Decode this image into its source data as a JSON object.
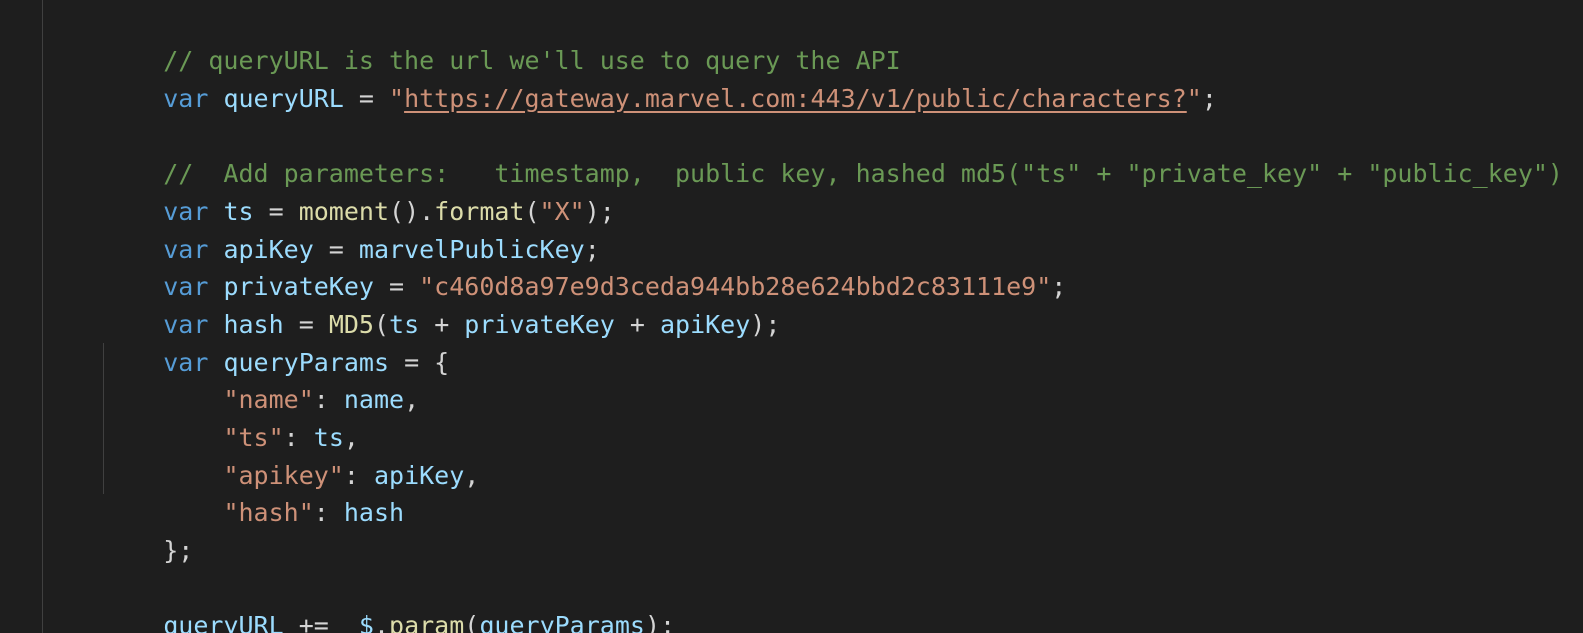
{
  "editor": {
    "l1": {
      "comment": "// queryURL is the url we'll use to query the API"
    },
    "l2": {
      "kw": "var",
      "sp1": " ",
      "name": "queryURL",
      "eq": " = ",
      "q1": "\"",
      "url": "https://gateway.marvel.com:443/v1/public/characters?",
      "q2": "\"",
      "semi": ";"
    },
    "l4": {
      "comment": "//  Add parameters:   timestamp,  public key, hashed md5(\"ts\" + \"private_key\" + \"public_key\")"
    },
    "l5": {
      "kw": "var",
      "sp1": " ",
      "name": "ts",
      "eq": " = ",
      "fn1": "moment",
      "p1": "().",
      "fn2": "format",
      "p2": "(",
      "str": "\"X\"",
      "p3": ");"
    },
    "l6": {
      "kw": "var",
      "sp1": " ",
      "name": "apiKey",
      "eq": " = ",
      "val": "marvelPublicKey",
      "semi": ";"
    },
    "l7": {
      "kw": "var",
      "sp1": " ",
      "name": "privateKey",
      "eq": " = ",
      "str": "\"c460d8a97e9d3ceda944bb28e624bbd2c83111e9\"",
      "semi": ";"
    },
    "l8": {
      "kw": "var",
      "sp1": " ",
      "name": "hash",
      "eq": " = ",
      "fn": "MD5",
      "p1": "(",
      "a1": "ts",
      "plus1": " + ",
      "a2": "privateKey",
      "plus2": " + ",
      "a3": "apiKey",
      "p2": ");"
    },
    "l9": {
      "kw": "var",
      "sp1": " ",
      "name": "queryParams",
      "eq": " = ",
      "brace": "{"
    },
    "l10": {
      "indent": "    ",
      "key": "\"name\"",
      "colon": ": ",
      "val": "name",
      "comma": ","
    },
    "l11": {
      "indent": "    ",
      "key": "\"ts\"",
      "colon": ": ",
      "val": "ts",
      "comma": ","
    },
    "l12": {
      "indent": "    ",
      "key": "\"apikey\"",
      "colon": ": ",
      "val": "apiKey",
      "comma": ","
    },
    "l13": {
      "indent": "    ",
      "key": "\"hash\"",
      "colon": ": ",
      "val": "hash"
    },
    "l14": {
      "close": "};"
    },
    "l16": {
      "name": "queryURL",
      "op": " +=  ",
      "jq": "$",
      "dot": ".",
      "fn": "param",
      "p1": "(",
      "arg": "queryParams",
      "p2": ");"
    }
  },
  "colors": {
    "background": "#1e1e1e",
    "comment": "#6a9955",
    "keyword": "#569cd6",
    "variable": "#9cdcfe",
    "function": "#dcdcaa",
    "string": "#ce9178",
    "punctuation": "#d4d4d4"
  }
}
